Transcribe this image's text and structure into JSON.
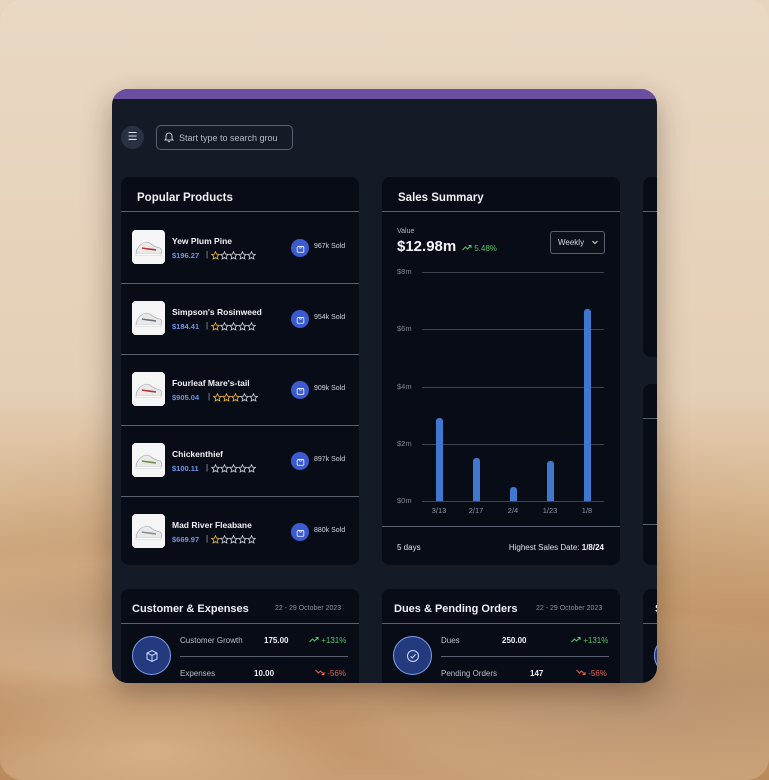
{
  "search": {
    "placeholder": "Start type to search grou"
  },
  "popular_products": {
    "title": "Popular Products",
    "items": [
      {
        "name": "Yew Plum Pine",
        "price": "$196.27",
        "rating": 1,
        "sold": "967k Sold"
      },
      {
        "name": "Simpson's Rosinweed",
        "price": "$184.41",
        "rating": 1,
        "sold": "954k Sold"
      },
      {
        "name": "Fourleaf Mare's-tail",
        "price": "$905.04",
        "rating": 3,
        "sold": "909k Sold"
      },
      {
        "name": "Chickenthief",
        "price": "$100.11",
        "rating": 0,
        "sold": "897k Sold"
      },
      {
        "name": "Mad River Fleabane",
        "price": "$669.97",
        "rating": 1,
        "sold": "880k Sold"
      }
    ]
  },
  "sales_summary": {
    "title": "Sales Summary",
    "value_label": "Value",
    "value": "$12.98m",
    "change": "5.48%",
    "period_select": "Weekly",
    "footer_left": "5 days",
    "footer_right_label": "Highest Sales Date:",
    "footer_right_value": "1/8/24"
  },
  "chart_data": {
    "type": "bar",
    "categories": [
      "3/13",
      "2/17",
      "2/4",
      "1/23",
      "1/8"
    ],
    "values": [
      2.9,
      1.5,
      0.5,
      1.4,
      6.7
    ],
    "ytick_labels": [
      "$8m",
      "$6m",
      "$4m",
      "$2m",
      "$0m"
    ],
    "ylim": [
      0,
      8
    ],
    "grid": true,
    "color": "#3f78cf"
  },
  "customer_expenses": {
    "title": "Customer & Expenses",
    "date": "22 - 29 October 2023",
    "rows": [
      {
        "label": "Customer Growth",
        "value": "175.00",
        "change": "+131%",
        "direction": "up"
      },
      {
        "label": "Expenses",
        "value": "10.00",
        "change": "-56%",
        "direction": "down"
      }
    ]
  },
  "dues_pending": {
    "title": "Dues & Pending Orders",
    "date": "22 - 29 October 2023",
    "rows": [
      {
        "label": "Dues",
        "value": "250.00",
        "change": "+131%",
        "direction": "up"
      },
      {
        "label": "Pending Orders",
        "value": "147",
        "change": "-56%",
        "direction": "down"
      }
    ]
  },
  "third_card": {
    "title_initial": "S"
  },
  "colors": {
    "accent": "#3c5bd1",
    "topbar": "#6a4fa0",
    "up": "#4fc46a",
    "down": "#e5604f",
    "star": "#e9b531"
  }
}
